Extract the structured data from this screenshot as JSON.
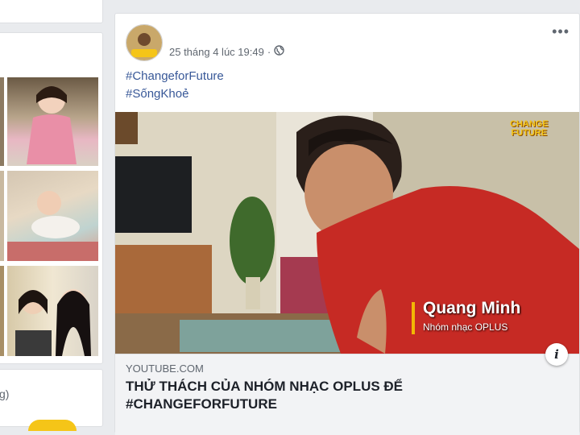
{
  "left_panel": {
    "partial_label": "g)"
  },
  "post": {
    "timestamp": "25 tháng 4 lúc 19:49",
    "separator": "·",
    "more_label": "•••",
    "hashtags": [
      "#ChangeforFuture",
      "#SốngKhoẻ"
    ],
    "video": {
      "caption_name": "Quang Minh",
      "caption_subtitle": "Nhóm nhạc OPLUS",
      "logo_line1": "CHANGE",
      "logo_line2": "FUTURE"
    },
    "link": {
      "domain": "YOUTUBE.COM",
      "title": "THỬ THÁCH CỦA NHÓM NHẠC OPLUS ĐỂ #CHANGEFORFUTURE",
      "info_label": "i"
    }
  },
  "colors": {
    "link": "#385898",
    "caption_accent": "#f2b705",
    "background": "#e9ebee"
  }
}
